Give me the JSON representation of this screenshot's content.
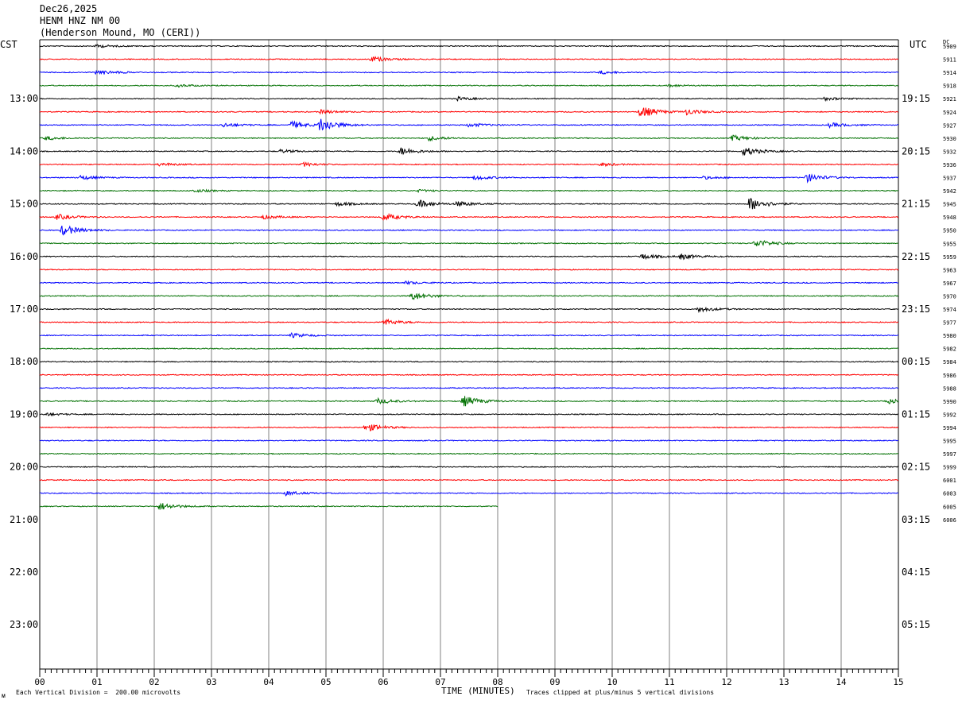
{
  "header": {
    "date": "Dec26,2025",
    "station": "HENM HNZ NM 00",
    "location": "(Henderson Mound, MO (CERI))"
  },
  "left_axis_title": "CST",
  "right_axis_title": "UTC",
  "dc_label": "DC",
  "footer": {
    "scale_note": "Each Vertical Division =  200.00 microvolts",
    "clip_note": "Traces clipped at plus/minus 5 vertical divisions",
    "logo_mark": "ᴍ"
  },
  "colors": {
    "trace_cycle": [
      "#000000",
      "#ff0000",
      "#0000ff",
      "#007000"
    ],
    "grid": "#808080"
  },
  "chart_data": {
    "type": "line",
    "xlabel": "TIME (MINUTES)",
    "xlim": [
      0,
      15
    ],
    "x_ticks": [
      "00",
      "01",
      "02",
      "03",
      "04",
      "05",
      "06",
      "07",
      "08",
      "09",
      "10",
      "11",
      "12",
      "13",
      "14",
      "15"
    ],
    "row_count": 36,
    "rows_per_hour": 4,
    "last_row_end_minute": 8,
    "left_hour_labels": [
      "13:00",
      "14:00",
      "15:00",
      "16:00",
      "17:00",
      "18:00",
      "19:00",
      "20:00",
      "21:00",
      "22:00",
      "23:00"
    ],
    "right_hour_labels": [
      "19:15",
      "20:15",
      "21:15",
      "22:15",
      "23:15",
      "00:15",
      "01:15",
      "02:15",
      "03:15",
      "04:15",
      "05:15"
    ],
    "dc_offsets": [
      "5909",
      "5911",
      "5914",
      "5918",
      "5921",
      "5924",
      "5927",
      "5930",
      "5932",
      "5936",
      "5937",
      "5942",
      "5945",
      "5948",
      "5950",
      "5955",
      "5959",
      "5963",
      "5967",
      "5970",
      "5974",
      "5977",
      "5980",
      "5982",
      "5984",
      "5986",
      "5988",
      "5990",
      "5992",
      "5994",
      "5995",
      "5997",
      "5999",
      "6001",
      "6003",
      "6005",
      "6006"
    ],
    "amplitude_units": "vertical divisions",
    "events": [
      {
        "row": 0,
        "minute": 1.0,
        "amp": 0.5
      },
      {
        "row": 1,
        "minute": 5.8,
        "amp": 1.0
      },
      {
        "row": 2,
        "minute": 1.0,
        "amp": 1.0
      },
      {
        "row": 2,
        "minute": 9.8,
        "amp": 0.6
      },
      {
        "row": 3,
        "minute": 2.4,
        "amp": 0.5
      },
      {
        "row": 3,
        "minute": 11.0,
        "amp": 0.4
      },
      {
        "row": 4,
        "minute": 7.3,
        "amp": 0.6
      },
      {
        "row": 4,
        "minute": 13.7,
        "amp": 0.6
      },
      {
        "row": 5,
        "minute": 10.5,
        "amp": 2.2
      },
      {
        "row": 5,
        "minute": 11.3,
        "amp": 1.0
      },
      {
        "row": 5,
        "minute": 4.9,
        "amp": 0.7
      },
      {
        "row": 6,
        "minute": 4.9,
        "amp": 2.5
      },
      {
        "row": 6,
        "minute": 4.4,
        "amp": 1.3
      },
      {
        "row": 6,
        "minute": 3.2,
        "amp": 0.8
      },
      {
        "row": 6,
        "minute": 7.5,
        "amp": 0.7
      },
      {
        "row": 6,
        "minute": 13.8,
        "amp": 0.8
      },
      {
        "row": 7,
        "minute": 6.8,
        "amp": 0.8
      },
      {
        "row": 7,
        "minute": 12.1,
        "amp": 1.0
      },
      {
        "row": 7,
        "minute": 0.1,
        "amp": 0.7
      },
      {
        "row": 8,
        "minute": 6.3,
        "amp": 1.4
      },
      {
        "row": 8,
        "minute": 12.3,
        "amp": 1.6
      },
      {
        "row": 8,
        "minute": 4.2,
        "amp": 0.6
      },
      {
        "row": 9,
        "minute": 4.6,
        "amp": 0.7
      },
      {
        "row": 9,
        "minute": 2.1,
        "amp": 0.6
      },
      {
        "row": 9,
        "minute": 9.8,
        "amp": 0.6
      },
      {
        "row": 10,
        "minute": 13.4,
        "amp": 1.6
      },
      {
        "row": 10,
        "minute": 0.7,
        "amp": 0.8
      },
      {
        "row": 10,
        "minute": 7.6,
        "amp": 0.8
      },
      {
        "row": 10,
        "minute": 11.6,
        "amp": 0.5
      },
      {
        "row": 11,
        "minute": 2.7,
        "amp": 0.5
      },
      {
        "row": 11,
        "minute": 6.6,
        "amp": 0.4
      },
      {
        "row": 12,
        "minute": 6.6,
        "amp": 1.5
      },
      {
        "row": 12,
        "minute": 12.4,
        "amp": 2.5
      },
      {
        "row": 12,
        "minute": 7.3,
        "amp": 0.9
      },
      {
        "row": 12,
        "minute": 5.2,
        "amp": 0.7
      },
      {
        "row": 13,
        "minute": 6.0,
        "amp": 1.3
      },
      {
        "row": 13,
        "minute": 0.3,
        "amp": 1.0
      },
      {
        "row": 13,
        "minute": 3.9,
        "amp": 0.7
      },
      {
        "row": 14,
        "minute": 0.4,
        "amp": 2.0
      },
      {
        "row": 15,
        "minute": 12.5,
        "amp": 1.5
      },
      {
        "row": 16,
        "minute": 10.5,
        "amp": 1.0
      },
      {
        "row": 16,
        "minute": 11.2,
        "amp": 1.0
      },
      {
        "row": 18,
        "minute": 6.4,
        "amp": 0.5
      },
      {
        "row": 19,
        "minute": 6.5,
        "amp": 1.5
      },
      {
        "row": 20,
        "minute": 11.5,
        "amp": 1.0
      },
      {
        "row": 21,
        "minute": 6.0,
        "amp": 1.2
      },
      {
        "row": 22,
        "minute": 4.4,
        "amp": 0.8
      },
      {
        "row": 27,
        "minute": 5.9,
        "amp": 1.0
      },
      {
        "row": 27,
        "minute": 7.4,
        "amp": 2.0
      },
      {
        "row": 27,
        "minute": 14.8,
        "amp": 1.0
      },
      {
        "row": 28,
        "minute": 0.1,
        "amp": 0.5
      },
      {
        "row": 29,
        "minute": 5.7,
        "amp": 1.5
      },
      {
        "row": 34,
        "minute": 4.3,
        "amp": 0.8
      },
      {
        "row": 35,
        "minute": 2.1,
        "amp": 1.4
      }
    ]
  }
}
